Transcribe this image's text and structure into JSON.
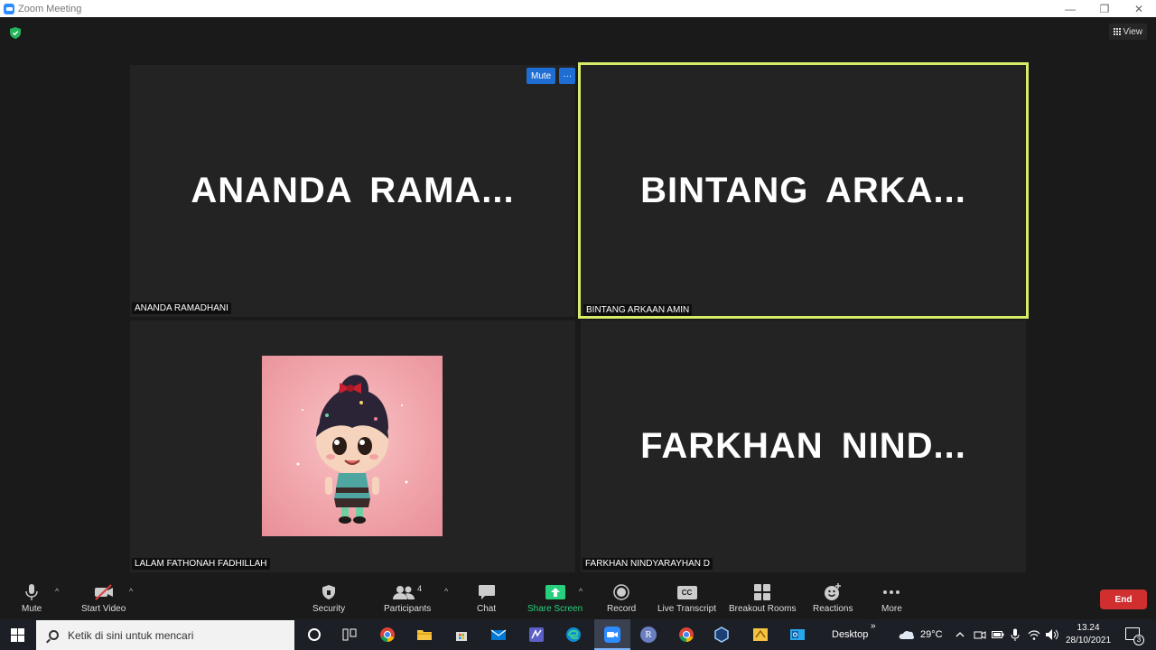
{
  "window": {
    "title": "Zoom Meeting",
    "controls": [
      "—",
      "❐",
      "✕"
    ]
  },
  "view_label": "View",
  "tile_tools": {
    "mute_label": "Mute",
    "more_label": "···"
  },
  "tiles": [
    {
      "big": "ANANDA  RAMA...",
      "label": "ANANDA RAMADHANI"
    },
    {
      "big": "BINTANG  ARKA...",
      "label": "BINTANG ARKAAN AMIN"
    },
    {
      "big": "",
      "label": "LALAM FATHONAH FADHILLAH"
    },
    {
      "big": "FARKHAN  NIND...",
      "label": "FARKHAN NINDYARAYHAN D"
    }
  ],
  "toolbar": {
    "mute": "Mute",
    "start_video": "Start Video",
    "security": "Security",
    "participants": "Participants",
    "participants_count": "4",
    "chat": "Chat",
    "share_screen": "Share Screen",
    "record": "Record",
    "live_transcript": "Live Transcript",
    "cc": "CC",
    "breakout_rooms": "Breakout Rooms",
    "reactions": "Reactions",
    "more": "More",
    "end": "End",
    "caret": "^"
  },
  "taskbar": {
    "search_placeholder": "Ketik di sini untuk mencari",
    "desktop_label": "Desktop",
    "chevrons": "»",
    "weather": "29°C",
    "time": "13.24",
    "date": "28/10/2021",
    "notification_count": "3",
    "r_label": "R"
  },
  "colors": {
    "accent": "#2d8cff",
    "active_speaker": "#d9ec6a",
    "end": "#d12f2f",
    "share": "#26d07c"
  }
}
